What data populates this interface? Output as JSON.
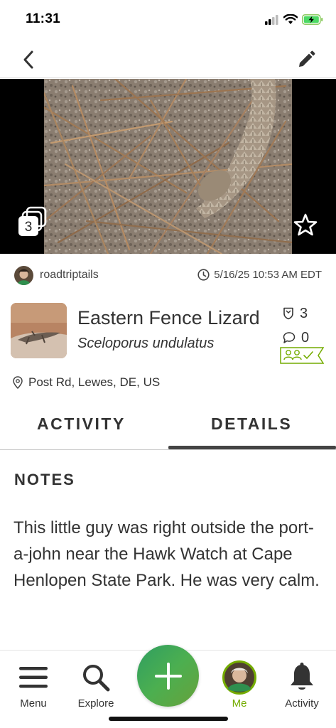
{
  "status": {
    "time": "11:31"
  },
  "photo": {
    "count": "3"
  },
  "observation": {
    "username": "roadtriptails",
    "date": "5/16/25 10:53 AM EDT",
    "common_name": "Eastern Fence Lizard",
    "scientific_name": "Sceloporus undulatus",
    "identifications_count": "3",
    "comments_count": "0",
    "location": "Post Rd, Lewes, DE, US"
  },
  "tabs": [
    {
      "label": "ACTIVITY",
      "selected": false
    },
    {
      "label": "DETAILS",
      "selected": true
    }
  ],
  "notes": {
    "title": "NOTES",
    "body": "This little guy was right outside the port-a-john near the Hawk Watch at Cape Henlopen State Park. He was very calm."
  },
  "bottom_nav": {
    "menu": "Menu",
    "explore": "Explore",
    "me": "Me",
    "activity": "Activity"
  },
  "colors": {
    "accent_green": "#74ac00",
    "fab_green": "#4caf50",
    "text": "#333333"
  },
  "icons": [
    "back-arrow-icon",
    "pencil-icon",
    "photo-stack-icon",
    "star-icon",
    "clock-icon",
    "id-shield-icon",
    "comment-icon",
    "research-grade-badge-icon",
    "location-pin-icon",
    "menu-icon",
    "search-icon",
    "plus-icon",
    "bell-icon"
  ]
}
